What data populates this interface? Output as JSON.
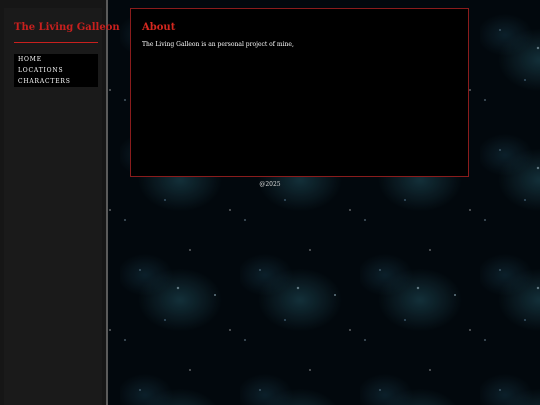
{
  "site": {
    "title": "The Living Galleon"
  },
  "nav": {
    "items": [
      {
        "label": "HOME"
      },
      {
        "label": "LOCATIONS"
      },
      {
        "label": "CHARACTERS"
      }
    ]
  },
  "main": {
    "heading": "About",
    "text": "The Living Galleon is an personal project of mine,"
  },
  "footer": {
    "text": "@2025"
  },
  "colors": {
    "accent": "#c8201e",
    "panel_border": "#8a1c1c",
    "sidebar_bg": "#161616",
    "panel_bg": "#000000"
  }
}
